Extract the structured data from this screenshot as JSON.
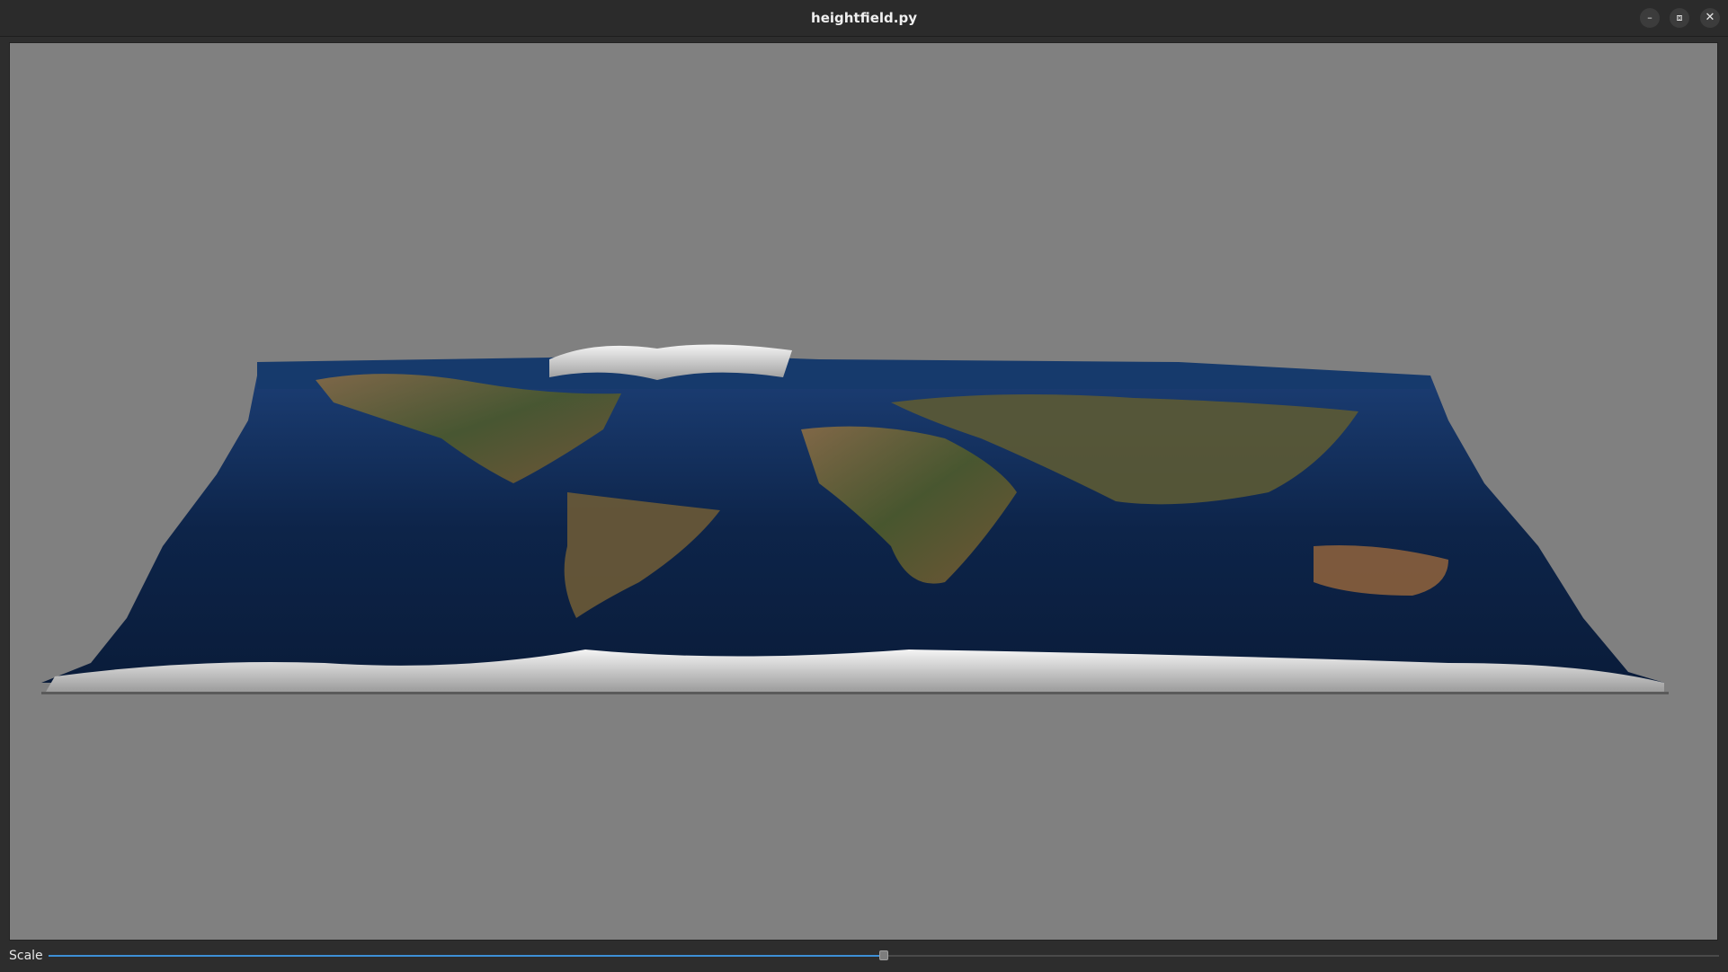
{
  "window": {
    "title": "heightfield.py",
    "controls": [
      "minimize-icon",
      "restore-icon",
      "close-icon"
    ]
  },
  "viewport": {
    "scene": "3D heightfield world map",
    "background_color": "#808080"
  },
  "controls": {
    "scale_label": "Scale",
    "scale_value": 0.5
  },
  "colors": {
    "accent": "#3d8fd6",
    "ocean": "#0f2a52",
    "land": "#6e5a3a",
    "ice": "#e8e8e8"
  }
}
